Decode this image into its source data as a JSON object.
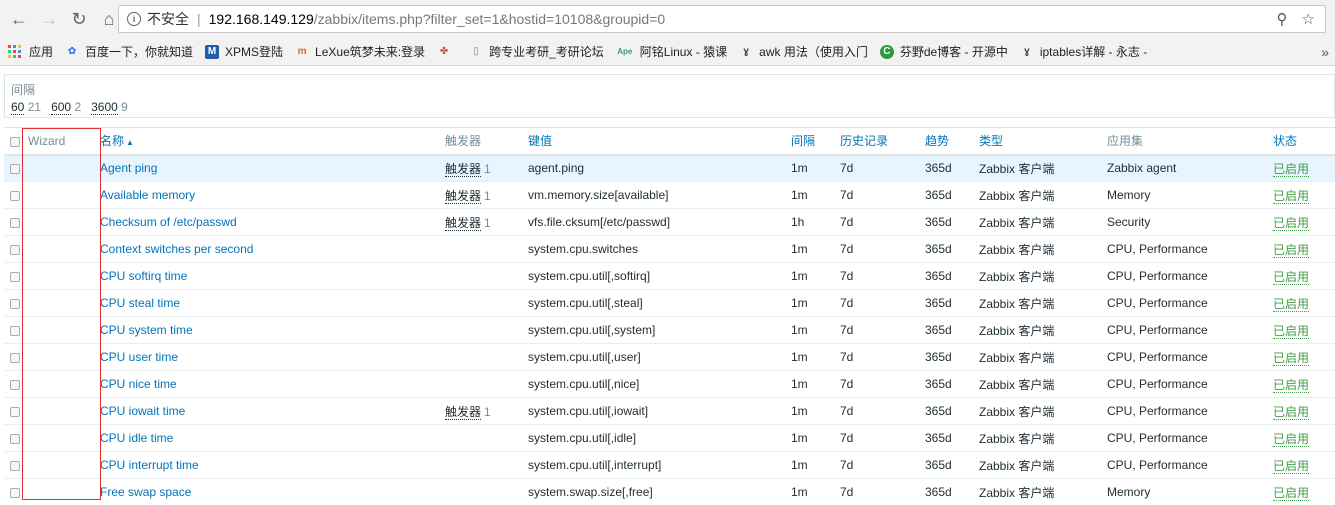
{
  "browser": {
    "insecure_label": "不安全",
    "url_host": "192.168.149.129",
    "url_path": "/zabbix/items.php?filter_set=1&hostid=10108&groupid=0"
  },
  "bookmarks": [
    {
      "label": "应用",
      "icon": "apps-grid-icon"
    },
    {
      "label": "百度一下，你就知道",
      "icon": "baidu-paw-icon"
    },
    {
      "label": "XPMS登陆",
      "icon": "xpms-icon"
    },
    {
      "label": "LeXue筑梦未来:登录",
      "icon": "lexue-icon"
    },
    {
      "label": "",
      "icon": "colorful-logo-icon"
    },
    {
      "label": "跨专业考研_考研论坛",
      "icon": "page-icon"
    },
    {
      "label": "阿铭Linux - 猿课",
      "icon": "apelearn-icon"
    },
    {
      "label": "awk 用法（使用入门",
      "icon": "awk-icon"
    },
    {
      "label": "芬野de博客 - 开源中",
      "icon": "oschina-icon"
    },
    {
      "label": "iptables详解 - 永志 -",
      "icon": "iptables-icon"
    }
  ],
  "filter": {
    "title": "间隔",
    "options": [
      {
        "interval": "60",
        "count": "21"
      },
      {
        "interval": "600",
        "count": "2"
      },
      {
        "interval": "3600",
        "count": "9"
      }
    ]
  },
  "table": {
    "headers": {
      "wizard": "Wizard",
      "name": "名称",
      "triggers": "触发器",
      "key": "键值",
      "interval": "间隔",
      "history": "历史记录",
      "trends": "趋势",
      "type": "类型",
      "applications": "应用集",
      "status": "状态"
    },
    "rows": [
      {
        "name": "Agent ping",
        "trigger": "触发器",
        "trigger_count": "1",
        "key": "agent.ping",
        "interval": "1m",
        "history": "7d",
        "trends": "365d",
        "type": "Zabbix 客户端",
        "app": "Zabbix agent",
        "status": "已启用"
      },
      {
        "name": "Available memory",
        "trigger": "触发器",
        "trigger_count": "1",
        "key": "vm.memory.size[available]",
        "interval": "1m",
        "history": "7d",
        "trends": "365d",
        "type": "Zabbix 客户端",
        "app": "Memory",
        "status": "已启用"
      },
      {
        "name": "Checksum of /etc/passwd",
        "trigger": "触发器",
        "trigger_count": "1",
        "key": "vfs.file.cksum[/etc/passwd]",
        "interval": "1h",
        "history": "7d",
        "trends": "365d",
        "type": "Zabbix 客户端",
        "app": "Security",
        "status": "已启用"
      },
      {
        "name": "Context switches per second",
        "trigger": "",
        "trigger_count": "",
        "key": "system.cpu.switches",
        "interval": "1m",
        "history": "7d",
        "trends": "365d",
        "type": "Zabbix 客户端",
        "app": "CPU, Performance",
        "status": "已启用"
      },
      {
        "name": "CPU softirq time",
        "trigger": "",
        "trigger_count": "",
        "key": "system.cpu.util[,softirq]",
        "interval": "1m",
        "history": "7d",
        "trends": "365d",
        "type": "Zabbix 客户端",
        "app": "CPU, Performance",
        "status": "已启用"
      },
      {
        "name": "CPU steal time",
        "trigger": "",
        "trigger_count": "",
        "key": "system.cpu.util[,steal]",
        "interval": "1m",
        "history": "7d",
        "trends": "365d",
        "type": "Zabbix 客户端",
        "app": "CPU, Performance",
        "status": "已启用"
      },
      {
        "name": "CPU system time",
        "trigger": "",
        "trigger_count": "",
        "key": "system.cpu.util[,system]",
        "interval": "1m",
        "history": "7d",
        "trends": "365d",
        "type": "Zabbix 客户端",
        "app": "CPU, Performance",
        "status": "已启用"
      },
      {
        "name": "CPU user time",
        "trigger": "",
        "trigger_count": "",
        "key": "system.cpu.util[,user]",
        "interval": "1m",
        "history": "7d",
        "trends": "365d",
        "type": "Zabbix 客户端",
        "app": "CPU, Performance",
        "status": "已启用"
      },
      {
        "name": "CPU nice time",
        "trigger": "",
        "trigger_count": "",
        "key": "system.cpu.util[,nice]",
        "interval": "1m",
        "history": "7d",
        "trends": "365d",
        "type": "Zabbix 客户端",
        "app": "CPU, Performance",
        "status": "已启用"
      },
      {
        "name": "CPU iowait time",
        "trigger": "触发器",
        "trigger_count": "1",
        "key": "system.cpu.util[,iowait]",
        "interval": "1m",
        "history": "7d",
        "trends": "365d",
        "type": "Zabbix 客户端",
        "app": "CPU, Performance",
        "status": "已启用"
      },
      {
        "name": "CPU idle time",
        "trigger": "",
        "trigger_count": "",
        "key": "system.cpu.util[,idle]",
        "interval": "1m",
        "history": "7d",
        "trends": "365d",
        "type": "Zabbix 客户端",
        "app": "CPU, Performance",
        "status": "已启用"
      },
      {
        "name": "CPU interrupt time",
        "trigger": "",
        "trigger_count": "",
        "key": "system.cpu.util[,interrupt]",
        "interval": "1m",
        "history": "7d",
        "trends": "365d",
        "type": "Zabbix 客户端",
        "app": "CPU, Performance",
        "status": "已启用"
      },
      {
        "name": "Free swap space",
        "trigger": "",
        "trigger_count": "",
        "key": "system.swap.size[,free]",
        "interval": "1m",
        "history": "7d",
        "trends": "365d",
        "type": "Zabbix 客户端",
        "app": "Memory",
        "status": "已启用"
      }
    ]
  },
  "colors": {
    "link": "#0275b8",
    "status_enabled": "#429e47",
    "highlight_row": "#e8f5ff",
    "annotation_box": "#e03030"
  }
}
